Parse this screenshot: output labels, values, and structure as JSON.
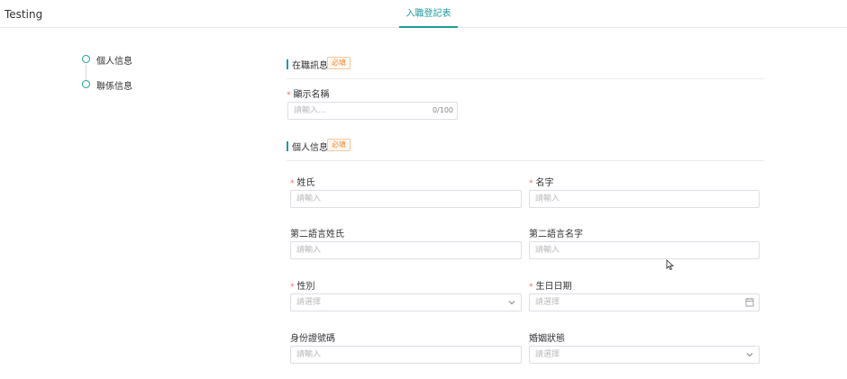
{
  "app": {
    "title": "Testing"
  },
  "tabs": [
    {
      "label": "入職登記表"
    }
  ],
  "steps": [
    {
      "label": "個人信息"
    },
    {
      "label": "聯係信息"
    }
  ],
  "sections": {
    "employment": {
      "title": "在職訊息",
      "badge": "必填"
    },
    "personal": {
      "title": "個人信息",
      "badge": "必填"
    }
  },
  "fields": {
    "display_name": {
      "label": "顯示名稱",
      "placeholder": "請輸入...",
      "count": "0/100",
      "required": true
    },
    "surname": {
      "label": "姓氏",
      "placeholder": "請輸入",
      "required": true
    },
    "given_name": {
      "label": "名字",
      "placeholder": "請輸入",
      "required": true
    },
    "second_surname": {
      "label": "第二語言姓氏",
      "placeholder": "請輸入",
      "required": false
    },
    "second_given_name": {
      "label": "第二語言名字",
      "placeholder": "請輸入",
      "required": false
    },
    "gender": {
      "label": "性別",
      "placeholder": "請選擇",
      "required": true
    },
    "birthday": {
      "label": "生日日期",
      "placeholder": "請選擇",
      "required": true
    },
    "id_number": {
      "label": "身份證號碼",
      "placeholder": "請輸入",
      "required": false
    },
    "marital_status": {
      "label": "婚姻狀態",
      "placeholder": "請選擇",
      "required": false
    }
  },
  "required_mark": "*",
  "colors": {
    "accent": "#1e9b9b",
    "required": "#f56c6c",
    "badge": "#f08c3a"
  }
}
